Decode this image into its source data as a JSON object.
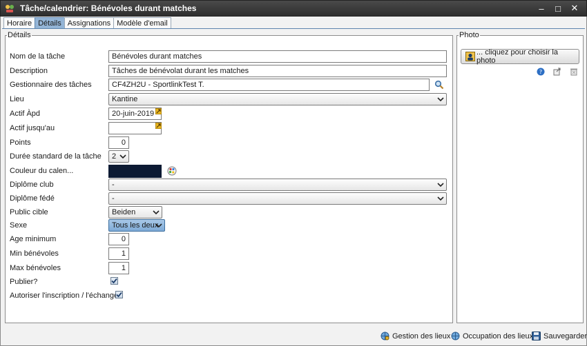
{
  "window": {
    "title": "Tâche/calendrier: Bénévoles durant matches",
    "controls": [
      "–",
      "□",
      "✕"
    ]
  },
  "tabs": [
    {
      "label": "Horaire",
      "active": false
    },
    {
      "label": "Détails",
      "active": true
    },
    {
      "label": "Assignations",
      "active": false
    },
    {
      "label": "Modèle d'email",
      "active": false
    }
  ],
  "details": {
    "legend": "Détails",
    "task_name": {
      "label": "Nom de la tâche",
      "value": "Bénévoles durant matches"
    },
    "description": {
      "label": "Description",
      "value": "Tâches de bénévolat durant les matches"
    },
    "task_manager": {
      "label": "Gestionnaire des tâches",
      "value": "CF4ZH2U - SportlinkTest T.",
      "icon": "search-icon"
    },
    "location": {
      "label": "Lieu",
      "value": "Kantine"
    },
    "active_from": {
      "label": "Actif Àpd",
      "value": "20-juin-2019"
    },
    "active_until": {
      "label": "Actif jusqu'au",
      "value": ""
    },
    "points": {
      "label": "Points",
      "value": "0"
    },
    "standard_duration": {
      "label": "Durée standard de la tâche",
      "value": "2"
    },
    "calendar_color": {
      "label": "Couleur du calen...",
      "color": "#0c1a33"
    },
    "club_diploma": {
      "label": "Diplôme club",
      "value": "-"
    },
    "federation_diploma": {
      "label": "Diplôme fédé",
      "value": "-"
    },
    "target_audience": {
      "label": "Public cible",
      "value": "Beiden"
    },
    "gender": {
      "label": "Sexe",
      "value": "Tous les deux"
    },
    "min_age": {
      "label": "Age minimum",
      "value": "0"
    },
    "min_volunteers": {
      "label": "Min bénévoles",
      "value": "1"
    },
    "max_volunteers": {
      "label": "Max bénévoles",
      "value": "1"
    },
    "publish": {
      "label": "Publier?",
      "checked": true
    },
    "allow_signup": {
      "label": "Autoriser l'inscription / l'échange?",
      "checked": true
    }
  },
  "photo": {
    "legend": "Photo",
    "choose_button": "... cliquez pour choisir la photo",
    "icons": [
      "help-icon",
      "export-icon",
      "delete-icon"
    ]
  },
  "footer": {
    "manage_locations": "Gestion des lieux",
    "location_occupancy": "Occupation des lieux",
    "save": "Sauvegarder"
  },
  "colors": {
    "titlebar": "#3a3a3a",
    "tab_active": "#93b4d6",
    "accent": "#3c6e9e"
  }
}
